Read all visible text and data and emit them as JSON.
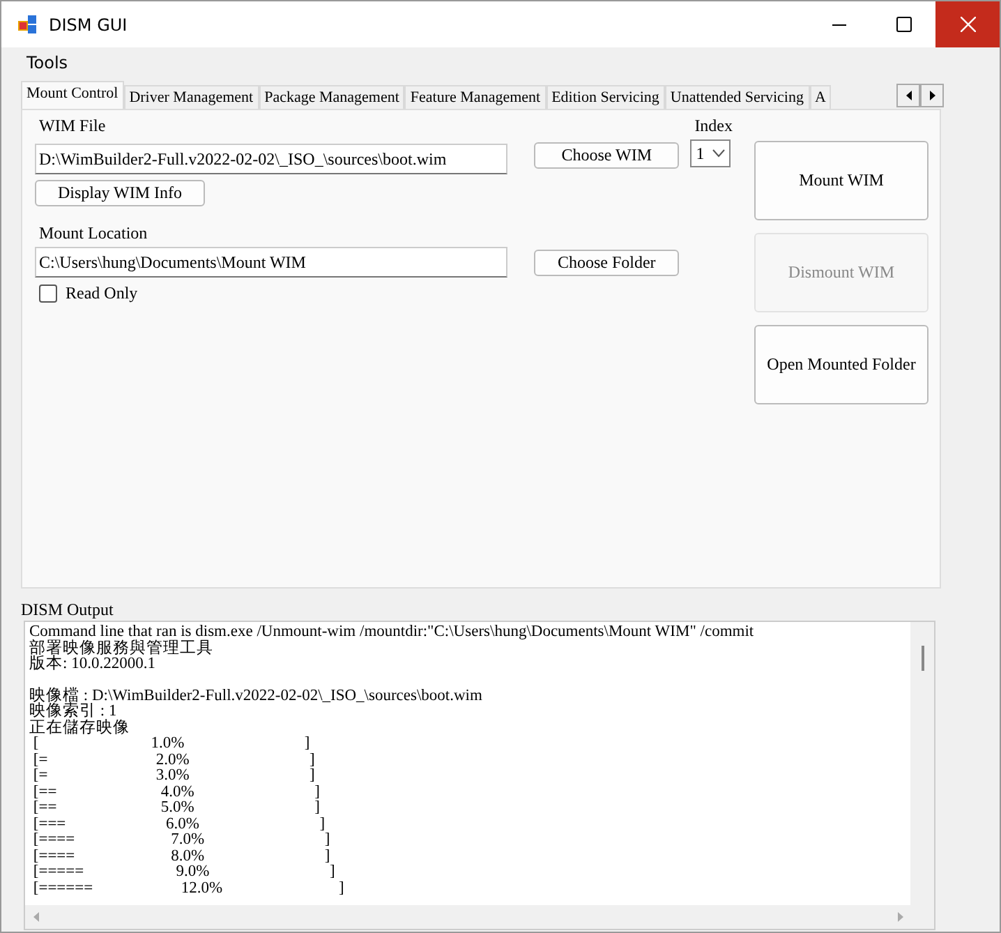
{
  "window": {
    "title": "DISM GUI"
  },
  "menu": [
    "Tools"
  ],
  "tabs": [
    {
      "label": "Mount Control",
      "selected": true
    },
    {
      "label": "Driver Management",
      "selected": false
    },
    {
      "label": "Package Management",
      "selected": false
    },
    {
      "label": "Feature Management",
      "selected": false
    },
    {
      "label": "Edition Servicing",
      "selected": false
    },
    {
      "label": "Unattended Servicing",
      "selected": false
    },
    {
      "label": "A",
      "selected": false
    }
  ],
  "mount": {
    "wim_label": "WIM File",
    "wim_value": "D:\\WimBuilder2-Full.v2022-02-02\\_ISO_\\sources\\boot.wim",
    "choose_wim": "Choose WIM",
    "display_info": "Display WIM Info",
    "index_label": "Index",
    "index_value": "1",
    "mount_label": "Mount Location",
    "mount_value": "C:\\Users\\hung\\Documents\\Mount WIM",
    "choose_folder": "Choose Folder",
    "read_only": {
      "label": "Read Only",
      "checked": false
    }
  },
  "actions": [
    {
      "label": "Mount WIM",
      "disabled": false
    },
    {
      "label": "Dismount WIM",
      "disabled": true
    },
    {
      "label": "Open Mounted Folder",
      "disabled": false
    }
  ],
  "output": {
    "label": "DISM Output",
    "blocks": [
      [
        "Command line that ran is dism.exe /Unmount-wim /mountdir:\"C:\\Users\\hung\\Documents\\Mount WIM\" /commit",
        "部署映像服務與管理工具",
        "版本: 10.0.22000.1"
      ],
      [
        "映像檔 : D:\\WimBuilder2-Full.v2022-02-02\\_ISO_\\sources\\boot.wim",
        "映像索引 : 1",
        "正在儲存映像",
        " [                            1.0%                              ]",
        " [=                           2.0%                              ]",
        " [=                           3.0%                              ]",
        " [==                          4.0%                              ]",
        " [==                          5.0%                              ]",
        " [===                         6.0%                              ]",
        " [====                        7.0%                              ]",
        " [====                        8.0%                              ]",
        " [=====                       9.0%                              ]",
        " [======                      12.0%                             ]"
      ]
    ]
  }
}
